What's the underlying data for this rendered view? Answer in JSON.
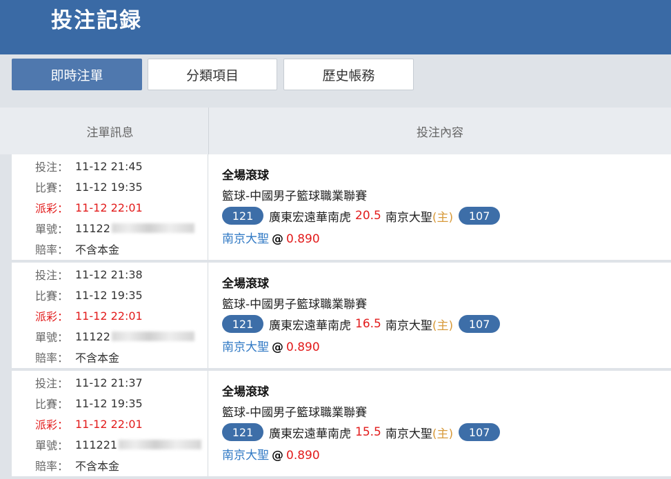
{
  "header": {
    "title": "投注記録"
  },
  "tabs": [
    {
      "label": "即時注單",
      "active": true
    },
    {
      "label": "分類項目",
      "active": false
    },
    {
      "label": "歷史帳務",
      "active": false
    }
  ],
  "table": {
    "headers": {
      "info": "注單訊息",
      "content": "投注內容"
    },
    "labels": {
      "bet_time": "投注：",
      "match_time": "比賽：",
      "payout_time": "派彩：",
      "order_no": "單號：",
      "odds_type": "賠率："
    },
    "rows": [
      {
        "bet_time": "11-12 21:45",
        "match_time": "11-12 19:35",
        "payout_time": "11-12 22:01",
        "order_no": "11122",
        "odds_type": "不含本金",
        "bet_type": "全場滾球",
        "league": "籃球-中國男子籃球職業聯賽",
        "away_score": "121",
        "away_team": "廣東宏遠華南虎",
        "handicap": "20.5",
        "home_team": "南京大聖",
        "home_mark": "(主)",
        "home_score": "107",
        "pick": "南京大聖",
        "at": "@",
        "odds": "0.890"
      },
      {
        "bet_time": "11-12 21:38",
        "match_time": "11-12 19:35",
        "payout_time": "11-12 22:01",
        "order_no": "11122",
        "odds_type": "不含本金",
        "bet_type": "全場滾球",
        "league": "籃球-中國男子籃球職業聯賽",
        "away_score": "121",
        "away_team": "廣東宏遠華南虎",
        "handicap": "16.5",
        "home_team": "南京大聖",
        "home_mark": "(主)",
        "home_score": "107",
        "pick": "南京大聖",
        "at": "@",
        "odds": "0.890"
      },
      {
        "bet_time": "11-12 21:37",
        "match_time": "11-12 19:35",
        "payout_time": "11-12 22:01",
        "order_no": "111221",
        "odds_type": "不含本金",
        "bet_type": "全場滾球",
        "league": "籃球-中國男子籃球職業聯賽",
        "away_score": "121",
        "away_team": "廣東宏遠華南虎",
        "handicap": "15.5",
        "home_team": "南京大聖",
        "home_mark": "(主)",
        "home_score": "107",
        "pick": "南京大聖",
        "at": "@",
        "odds": "0.890"
      }
    ]
  },
  "colors": {
    "header_bg": "#3a6aa5",
    "active_tab": "#4f78ae",
    "red": "#e21b1b",
    "pill": "#3d6ea8",
    "link": "#2f78c4",
    "home_mark": "#d89a3a"
  }
}
